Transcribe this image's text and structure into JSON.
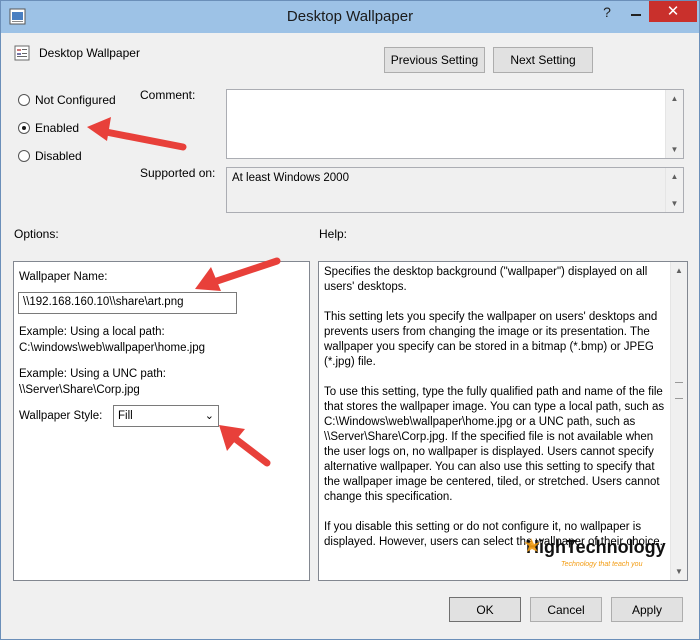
{
  "window": {
    "title": "Desktop Wallpaper",
    "help_glyph": "?",
    "close_glyph": "✕"
  },
  "policy": {
    "name": "Desktop Wallpaper",
    "icon": "policy-settings-icon"
  },
  "nav": {
    "previous": "Previous Setting",
    "next": "Next Setting"
  },
  "state": {
    "options": [
      {
        "label": "Not Configured",
        "selected": false
      },
      {
        "label": "Enabled",
        "selected": true
      },
      {
        "label": "Disabled",
        "selected": false
      }
    ]
  },
  "comment": {
    "label": "Comment:",
    "value": ""
  },
  "supported": {
    "label": "Supported on:",
    "value": "At least Windows 2000"
  },
  "options_section": {
    "header": "Options:",
    "wallpaper_name_label": "Wallpaper Name:",
    "wallpaper_name_value": "\\\\192.168.160.10\\\\share\\art.png",
    "example_local_1": "Example: Using a local path:",
    "example_local_2": "C:\\windows\\web\\wallpaper\\home.jpg",
    "example_unc_1": "Example: Using a UNC path:",
    "example_unc_2": "\\\\Server\\Share\\Corp.jpg",
    "style_label": "Wallpaper Style:",
    "style_value": "Fill"
  },
  "help_section": {
    "header": "Help:",
    "paragraphs": [
      "Specifies the desktop background (\"wallpaper\") displayed on all users' desktops.",
      "This setting lets you specify the wallpaper on users' desktops and prevents users from changing the image or its presentation. The wallpaper you specify can be stored in a bitmap (*.bmp) or JPEG (*.jpg) file.",
      "To use this setting, type the fully qualified path and name of the file that stores the wallpaper image. You can type a local path, such as C:\\Windows\\web\\wallpaper\\home.jpg or a UNC path, such as \\\\Server\\Share\\Corp.jpg. If the specified file is not available when the user logs on, no wallpaper is displayed. Users cannot specify alternative wallpaper. You can also use this setting to specify that the wallpaper image be centered, tiled, or stretched. Users cannot change this specification.",
      "If you disable this setting or do not configure it, no wallpaper is displayed. However, users can select the wallpaper of their choice."
    ]
  },
  "buttons": {
    "ok": "OK",
    "cancel": "Cancel",
    "apply": "Apply"
  },
  "watermark": {
    "brand": "HighTechnology",
    "tagline": "Technology that teach you"
  },
  "colors": {
    "titlebar": "#9dc2e6",
    "close": "#c9302c",
    "annotation_arrow": "#e8403a",
    "watermark_orange": "#f39c12"
  }
}
